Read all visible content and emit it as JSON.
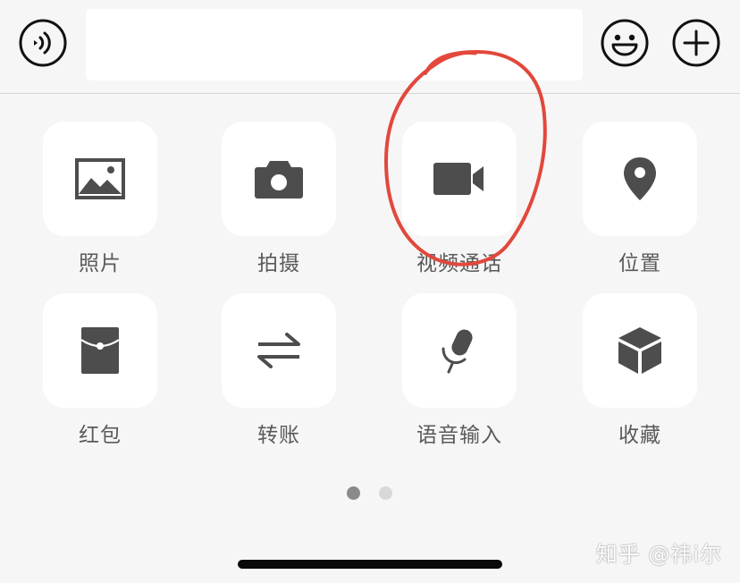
{
  "input_bar": {
    "message_value": "",
    "placeholder": ""
  },
  "panel": {
    "items": [
      {
        "label": "照片",
        "icon": "photo-icon"
      },
      {
        "label": "拍摄",
        "icon": "camera-icon"
      },
      {
        "label": "视频通话",
        "icon": "video-call-icon"
      },
      {
        "label": "位置",
        "icon": "location-icon"
      },
      {
        "label": "红包",
        "icon": "red-packet-icon"
      },
      {
        "label": "转账",
        "icon": "transfer-icon"
      },
      {
        "label": "语音输入",
        "icon": "microphone-icon"
      },
      {
        "label": "收藏",
        "icon": "favorites-cube-icon"
      }
    ]
  },
  "pager": {
    "current_page": 1,
    "total_pages": 2
  },
  "watermark": {
    "text": "知乎 @祎i尔"
  },
  "colors": {
    "background": "#f6f6f6",
    "tile": "#ffffff",
    "icon": "#4d4d4d",
    "label": "#5a5a5a",
    "annotation_red": "#e2483c"
  }
}
